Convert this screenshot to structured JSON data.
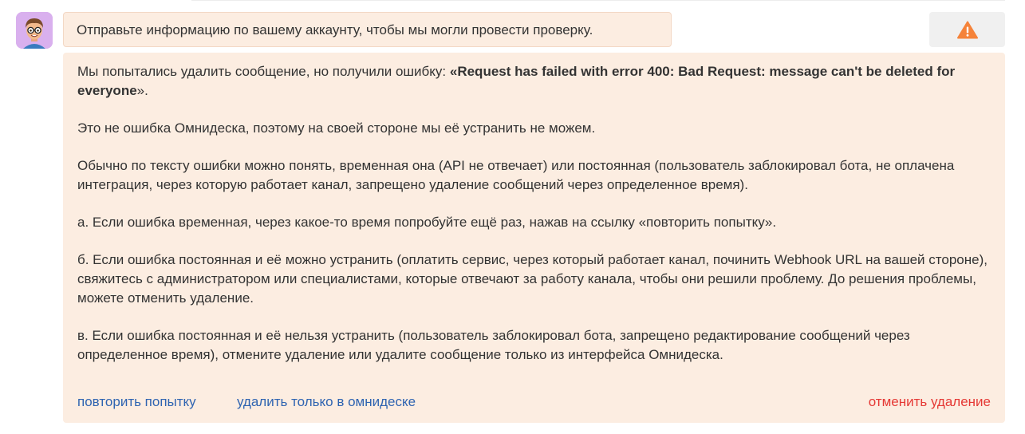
{
  "message": {
    "text": "Отправьте информацию по вашему аккаунту, чтобы мы могли провести проверку."
  },
  "error_panel": {
    "intro_prefix": "Мы попытались удалить сообщение, но получили ошибку: ",
    "error_quoted": "«Request has failed with error 400: Bad Request: message can't be deleted for everyone",
    "intro_suffix": "».",
    "paragraph_1": "Это не ошибка Омнидеска, поэтому на своей стороне мы её устранить не можем.",
    "paragraph_2": "Обычно по тексту ошибки можно понять, временная она (API не отвечает) или постоянная (пользователь заблокировал бота, не оплачена интеграция, через которую работает канал, запрещено удаление сообщений через определенное время).",
    "paragraph_a": "а. Если ошибка временная, через какое-то время попробуйте ещё раз, нажав на ссылку «повторить попытку».",
    "paragraph_b": "б. Если ошибка постоянная и её можно устранить (оплатить сервис, через который работает канал, починить Webhook URL на вашей стороне), свяжитесь с администратором или специалистами, которые отвечают за работу канала, чтобы они решили проблему. До решения проблемы, можете отменить удаление.",
    "paragraph_c": "в. Если ошибка постоянная и её нельзя устранить (пользователь заблокировал бота, запрещено редактирование сообщений через определенное время), отмените удаление или удалите сообщение только из интерфейса Омнидеска."
  },
  "actions": {
    "retry": "повторить попытку",
    "delete_only_omnidesk": "удалить только в омнидеске",
    "cancel_delete": "отменить удаление"
  },
  "icons": {
    "avatar": "memoji-avatar",
    "warning": "warning-triangle-icon"
  },
  "colors": {
    "panel_bg": "#fcede1",
    "link_blue": "#2f64b1",
    "cancel_red": "#e53935",
    "warning_orange": "#f5833a",
    "avatar_bg": "#d9b0ee"
  }
}
